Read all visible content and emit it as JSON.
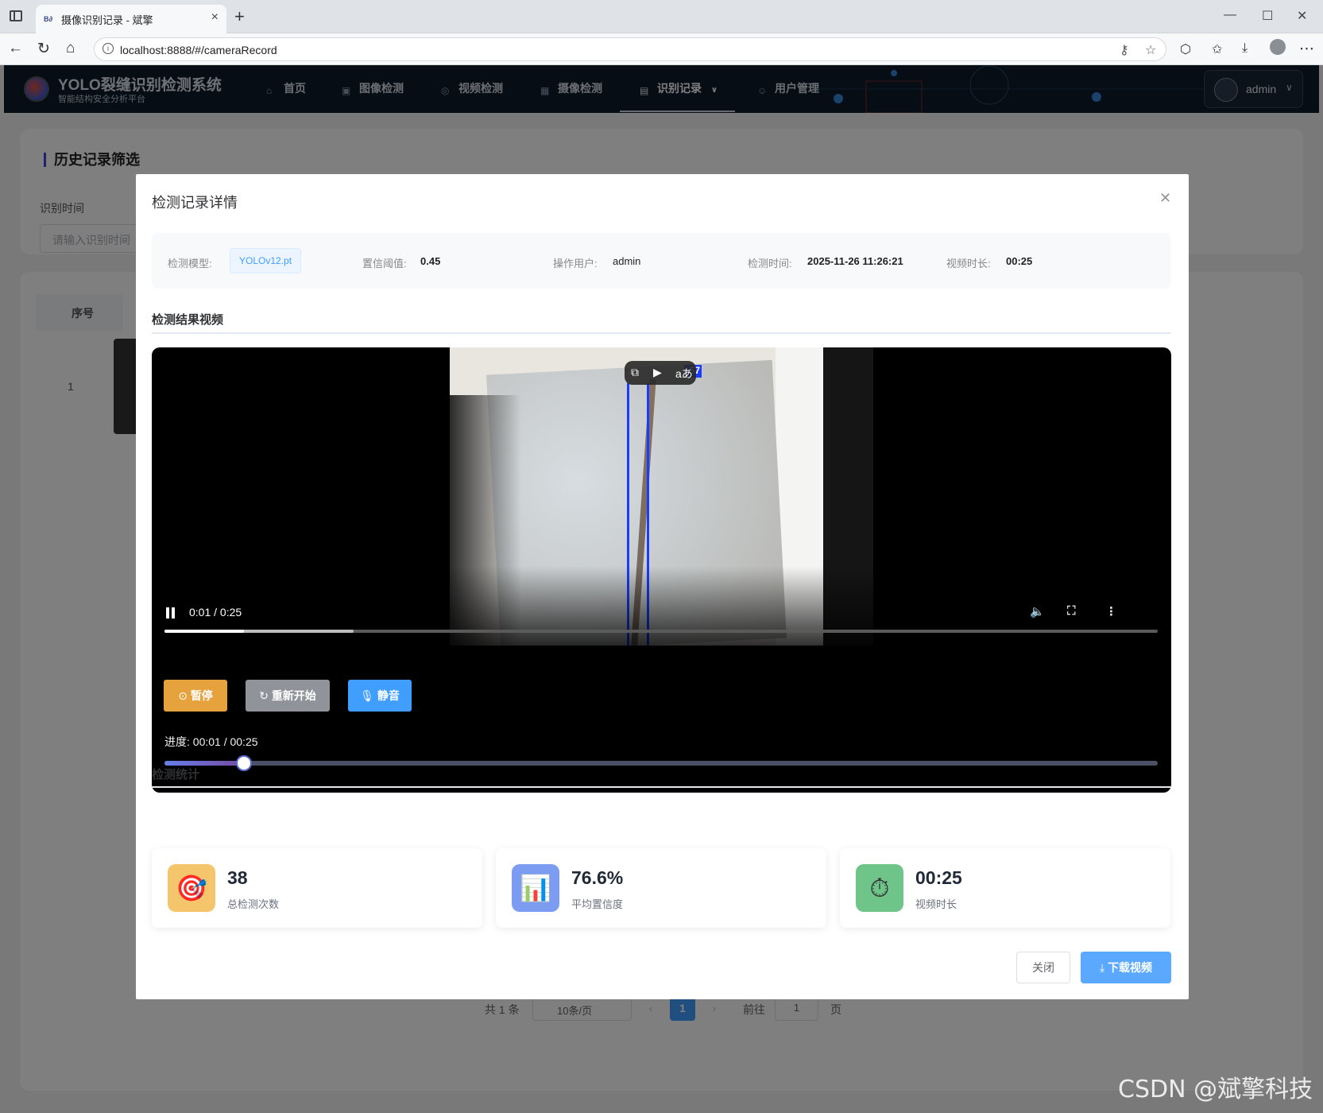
{
  "browser": {
    "tab_title": "摄像识别记录 - 斌擎",
    "tab_favicon": "B∂",
    "url": "localhost:8888/#/cameraRecord"
  },
  "header": {
    "app_title": "YOLO裂缝识别检测系统",
    "app_subtitle": "智能结构安全分析平台",
    "nav": [
      {
        "label": "首页",
        "icon": "home-icon"
      },
      {
        "label": "图像检测",
        "icon": "image-icon"
      },
      {
        "label": "视频检测",
        "icon": "video-icon"
      },
      {
        "label": "摄像检测",
        "icon": "camera-icon"
      },
      {
        "label": "识别记录",
        "icon": "document-icon",
        "active": true
      },
      {
        "label": "用户管理",
        "icon": "user-icon"
      }
    ],
    "user": "admin"
  },
  "page": {
    "filter_title": "历史记录筛选",
    "filter_label": "识别时间",
    "filter_placeholder": "请输入识别时间",
    "table_header_index": "序号",
    "row_index": "1",
    "pagination": {
      "total": "共 1 条",
      "page_size": "10条/页",
      "current": "1",
      "goto_label": "前往",
      "goto_value": "1",
      "page_suffix": "页"
    }
  },
  "dialog": {
    "title": "检测记录详情",
    "info": {
      "model_label": "检测模型:",
      "model_value": "YOLOv12.pt",
      "conf_label": "置信阈值:",
      "conf_value": "0.45",
      "user_label": "操作用户:",
      "user_value": "admin",
      "time_label": "检测时间:",
      "time_value": "2025-11-26 11:26:21",
      "duration_label": "视频时长:",
      "duration_value": "00:25"
    },
    "video_section_title": "检测结果视频",
    "video": {
      "time_display": "0:01 / 0:25",
      "detection_label": "57",
      "played_fraction": 0.08,
      "buffered_fraction": 0.19,
      "buttons": {
        "pause": "暂停",
        "restart": "重新开始",
        "mute": "静音"
      },
      "progress_text": "进度: 00:01 / 00:25",
      "slider_fraction": 0.08
    },
    "stats_section_title": "检测统计",
    "stats": [
      {
        "value": "38",
        "label": "总检测次数",
        "icon": "target-icon",
        "symbol": "🎯",
        "bg": "#f5c56b"
      },
      {
        "value": "76.6%",
        "label": "平均置信度",
        "icon": "bar-chart-icon",
        "symbol": "📊",
        "bg": "#7b9cf0"
      },
      {
        "value": "00:25",
        "label": "视频时长",
        "icon": "stopwatch-icon",
        "symbol": "⏱",
        "bg": "#6fc48a"
      }
    ],
    "close_label": "关闭",
    "download_label": "下载视频"
  },
  "watermark": "CSDN @斌擎科技"
}
